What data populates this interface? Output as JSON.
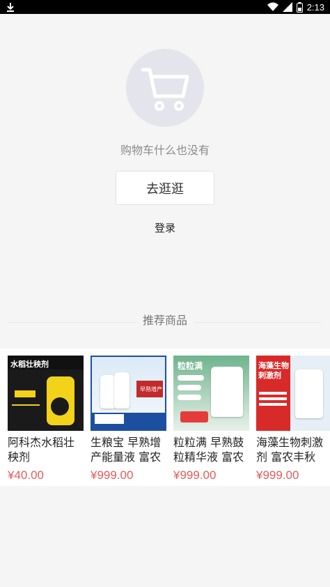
{
  "status_bar": {
    "time": "2:13",
    "icons": [
      "download-icon",
      "wifi-icon",
      "signal-icon",
      "battery-icon"
    ]
  },
  "empty_cart": {
    "icon": "shopping-cart-icon",
    "message": "购物车什么也没有",
    "go_button": "去逛逛",
    "login_link": "登录"
  },
  "recommend": {
    "title": "推荐商品",
    "products": [
      {
        "name": "阿科杰水稻壮秧剂",
        "price": "¥40.00",
        "image_text": "水稻壮秧剂"
      },
      {
        "name": "生粮宝 早熟增产能量液 富农",
        "price": "¥999.00",
        "image_text": "早熟增产"
      },
      {
        "name": "粒粒满 早熟鼓粒精华液 富农",
        "price": "¥999.00",
        "image_text": "粒粒满"
      },
      {
        "name": "海藻生物刺激剂 富农丰秋",
        "price": "¥999.00",
        "image_text": "海藻生物刺激剂"
      }
    ]
  },
  "colors": {
    "price": "#e35b5b",
    "circle_bg": "#e4e5ec",
    "cart_icon": "#ffffff"
  }
}
